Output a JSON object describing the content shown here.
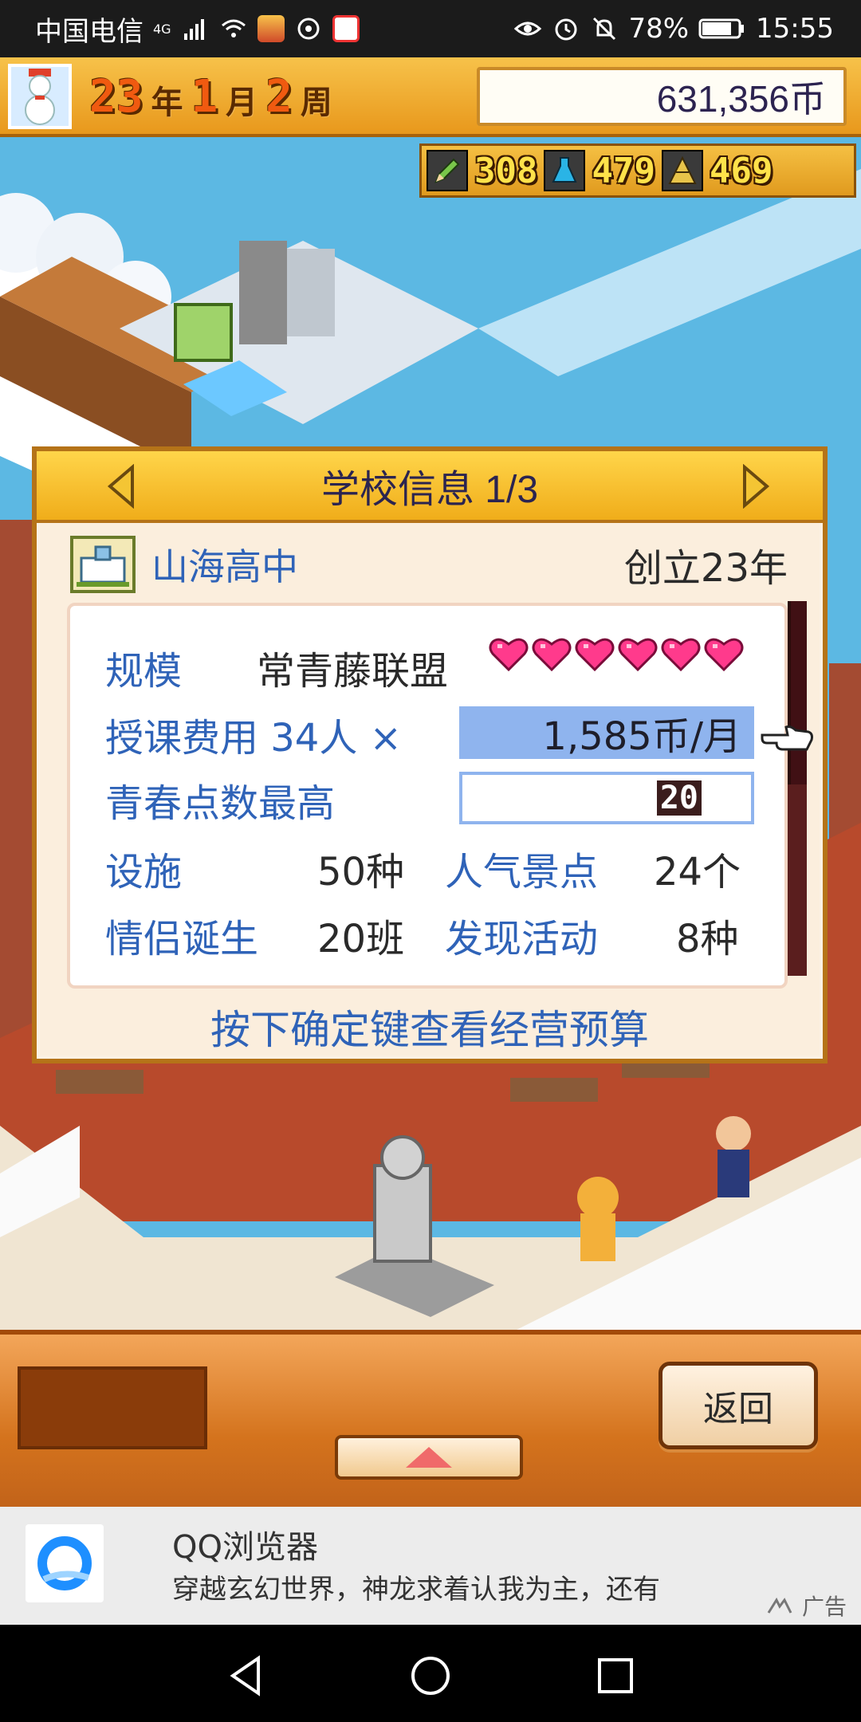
{
  "status_bar": {
    "carrier": "中国电信",
    "network": "4G",
    "battery": "78%",
    "time": "15:55"
  },
  "top_bar": {
    "year_num": "23",
    "year_unit": "年",
    "month_num": "1",
    "month_unit": "月",
    "week_num": "2",
    "week_unit": "周",
    "money": "631,356币"
  },
  "resources": [
    {
      "icon": "pencil-icon",
      "value": "308"
    },
    {
      "icon": "flask-icon",
      "value": "479"
    },
    {
      "icon": "pyramid-icon",
      "value": "469"
    }
  ],
  "dialog": {
    "title": "学校信息 1/3",
    "school_name": "山海高中",
    "founded": "创立23年",
    "scale_label": "规模",
    "scale_value": "常青藤联盟",
    "hearts": 6,
    "tuition_label": "授课费用 34人 ×",
    "tuition_value": "1,585币/月",
    "youth_label": "青春点数最高",
    "youth_value": "20",
    "facilities_label": "设施",
    "facilities_value": "50种",
    "popular_label": "人气景点",
    "popular_value": "24个",
    "couples_label": "情侣诞生",
    "couples_value": "20班",
    "activities_label": "发现活动",
    "activities_value": "8种",
    "hint": "按下确定键查看经营预算"
  },
  "controls": {
    "back_label": "返回"
  },
  "ad": {
    "title": "QQ浏览器",
    "description": "穿越玄幻世界，神龙求着认我为主，还有",
    "tag": "广告"
  },
  "colors": {
    "label_blue": "#2f63b8",
    "heart_pink": "#ff3a8c",
    "header_gold": "#f0ad1a"
  }
}
